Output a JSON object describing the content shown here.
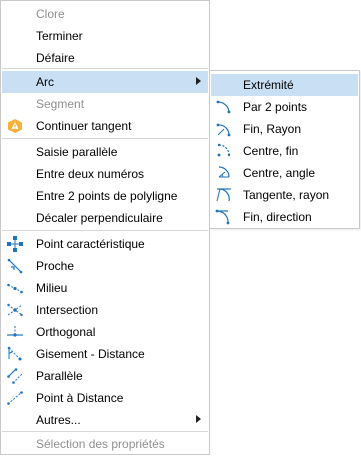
{
  "menu": {
    "clore": "Clore",
    "terminer": "Terminer",
    "defaire": "Défaire",
    "arc": "Arc",
    "segment": "Segment",
    "continuer_tangent": "Continuer tangent",
    "saisie_parallele": "Saisie parallèle",
    "entre_deux_numeros": "Entre deux numéros",
    "entre_2_points_polyligne": "Entre 2 points de polyligne",
    "decaler_perpendiculaire": "Décaler perpendiculaire",
    "point_caracteristique": "Point caractéristique",
    "proche": "Proche",
    "milieu": "Milieu",
    "intersection": "Intersection",
    "orthogonal": "Orthogonal",
    "gisement_distance": "Gisement - Distance",
    "parallele": "Parallèle",
    "point_a_distance": "Point à Distance",
    "autres": "Autres...",
    "selection_proprietes": "Sélection des propriétés"
  },
  "arc_submenu": {
    "extremite": "Extrémité",
    "par_2_points": "Par 2 points",
    "fin_rayon": "Fin, Rayon",
    "centre_fin": "Centre, fin",
    "centre_angle": "Centre, angle",
    "tangente_rayon": "Tangente, rayon",
    "fin_direction": "Fin, direction"
  },
  "colors": {
    "highlight": "#c9dff3",
    "icon_blue": "#1e73be",
    "disabled_text": "#8f8f8f",
    "warning_orange": "#f4b23a"
  }
}
